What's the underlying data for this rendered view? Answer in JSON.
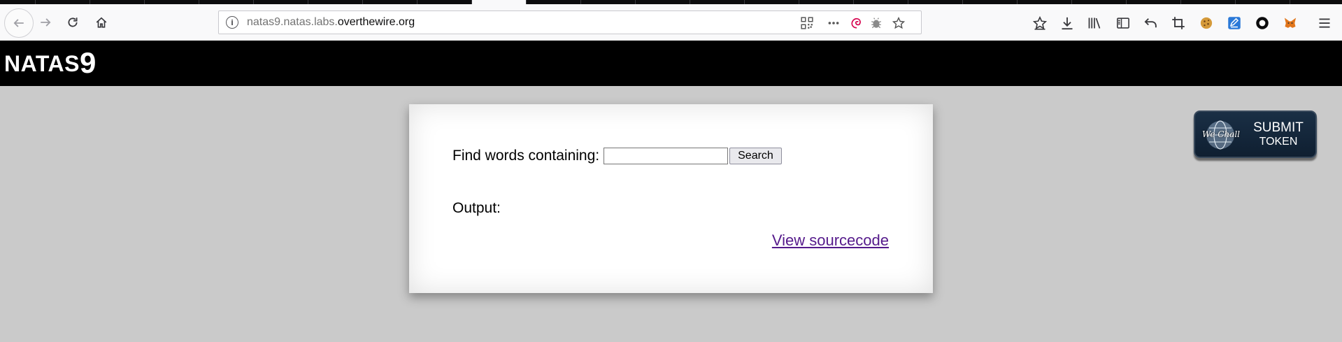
{
  "browser": {
    "url_prefix": "natas9.natas.labs.",
    "url_host": "overthewire.org"
  },
  "header": {
    "title_text": "NATAS",
    "title_number": "9"
  },
  "form": {
    "find_label": "Find words containing:",
    "search_value": "",
    "search_button": "Search",
    "output_label": "Output:",
    "output_value": "",
    "view_source_link": "View sourcecode"
  },
  "token": {
    "brand": "We Chall",
    "line1": "SUBMIT",
    "line2": "TOKEN"
  },
  "colors": {
    "page_bg": "#cacaca",
    "header_bg": "#000000",
    "link": "#551a8b"
  }
}
